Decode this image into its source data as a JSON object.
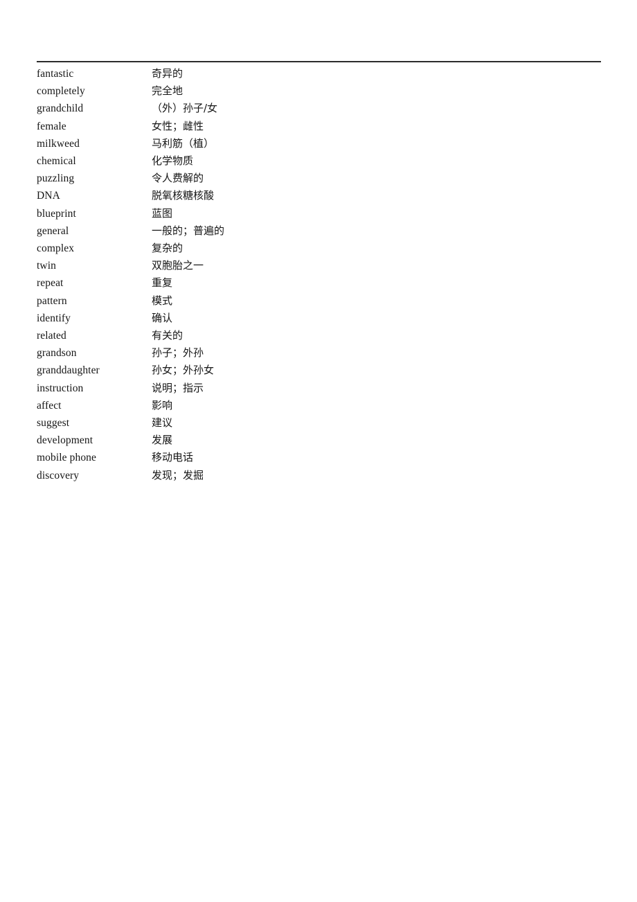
{
  "document": {
    "type": "vocabulary-glossary",
    "rule_color": "#2b2b2b"
  },
  "glossary": {
    "columns": [
      "term",
      "meaning"
    ],
    "entries": [
      {
        "term": "fantastic",
        "meaning": "奇异的"
      },
      {
        "term": "completely",
        "meaning": "完全地"
      },
      {
        "term": "grandchild",
        "meaning": "（外）孙子/女"
      },
      {
        "term": "female",
        "meaning": "女性；雌性"
      },
      {
        "term": "milkweed",
        "meaning": "马利筋（植）"
      },
      {
        "term": "chemical",
        "meaning": "化学物质"
      },
      {
        "term": "puzzling",
        "meaning": "令人费解的"
      },
      {
        "term": "DNA",
        "meaning": "脱氧核糖核酸"
      },
      {
        "term": "blueprint",
        "meaning": "蓝图"
      },
      {
        "term": "general",
        "meaning": "一般的；普遍的"
      },
      {
        "term": "complex",
        "meaning": "复杂的"
      },
      {
        "term": "twin",
        "meaning": "双胞胎之一"
      },
      {
        "term": "repeat",
        "meaning": "重复"
      },
      {
        "term": "pattern",
        "meaning": "模式"
      },
      {
        "term": "identify",
        "meaning": "确认"
      },
      {
        "term": "related",
        "meaning": "有关的"
      },
      {
        "term": "grandson",
        "meaning": "孙子；外孙"
      },
      {
        "term": "granddaughter",
        "meaning": "孙女；外孙女"
      },
      {
        "term": "instruction",
        "meaning": "说明；指示"
      },
      {
        "term": "affect",
        "meaning": "影响"
      },
      {
        "term": "suggest",
        "meaning": "建议"
      },
      {
        "term": "development",
        "meaning": "发展"
      },
      {
        "term": "mobile phone",
        "meaning": "移动电话"
      },
      {
        "term": "discovery",
        "meaning": "发现；发掘"
      }
    ]
  }
}
